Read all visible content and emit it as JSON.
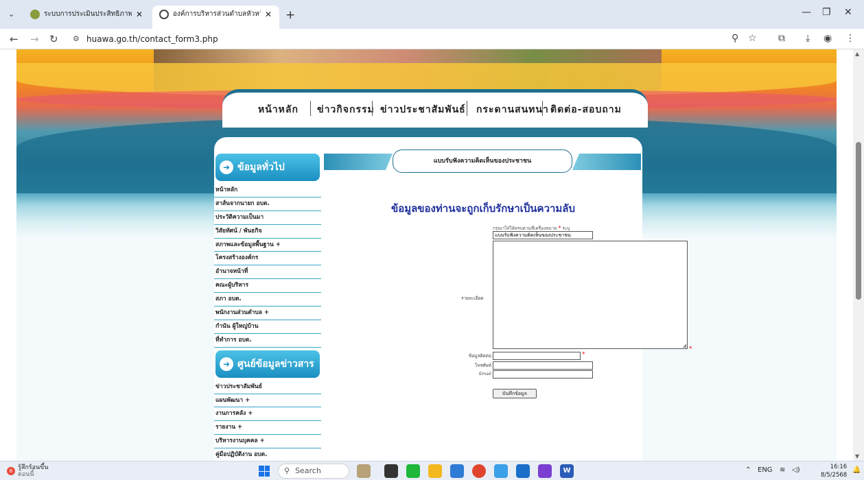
{
  "browser": {
    "tabs": [
      {
        "title": "ระบบการประเมินประสิทธิภาพขององค์",
        "active": false
      },
      {
        "title": "องค์การบริหารส่วนตำบลหัวหว้า อำเภ",
        "active": true
      }
    ],
    "url": "huawa.go.th/contact_form3.php"
  },
  "site": {
    "menu": [
      "หน้าหลัก",
      "ข่าวกิจกรรม",
      "ข่าวประชาสัมพันธ์",
      "กระดานสนทนา",
      "ติดต่อ-สอบถาม"
    ],
    "sidebar_general_title": "ข้อมูลทั่วไป",
    "sidebar_general_items": [
      "หน้าหลัก",
      "สาส์นจากนายก อบต.",
      "ประวัติความเป็นมา",
      "วิสัยทัศน์ / พันธกิจ",
      "สภาพและข้อมูลพื้นฐาน +",
      "โครงสร้างองค์กร",
      "อำนาจหน้าที่",
      "คณะผู้บริหาร",
      "สภา อบต.",
      "พนักงานส่วนตำบล +",
      "กำนัน ผู้ใหญ่บ้าน",
      "ที่ทำการ อบต."
    ],
    "sidebar_news_title": "ศูนย์ข้อมูลข่าวสาร",
    "sidebar_news_items": [
      "ข่าวประชาสัมพันธ์",
      "แผนพัฒนา +",
      "งานการคลัง +",
      "รายงาน +",
      "บริหารงานบุคคล +",
      "คู่มือปฏิบัติงาน อบต."
    ]
  },
  "form": {
    "header": "แบบรับฟังความคิดเห็นของประชาชน",
    "confidential": "ข้อมูลของท่านจะถูกเก็บรักษาเป็นความลับ",
    "hint": "กรุณาใส่ให้ครบตามที่เครื่องหมาย",
    "hint_star": "*",
    "hint_suffix": "ระบุ",
    "subject_value": "แบบรับฟังความคิดเห็นของประชาชน",
    "detail_label": "รายละเอียด",
    "contact_label": "ข้อมูลติดต่อ",
    "phone_label": "โทรศัพท์",
    "email_label": "Email",
    "save_label": "บันทึกข้อมูล"
  },
  "taskbar": {
    "weather_badge": "6",
    "weather_line1": "รู้สึกร้อนขึ้น",
    "weather_line2": "ตอนนี้",
    "search_label": "Search",
    "lang": "ENG",
    "time": "16:16",
    "date": "8/5/2568"
  }
}
